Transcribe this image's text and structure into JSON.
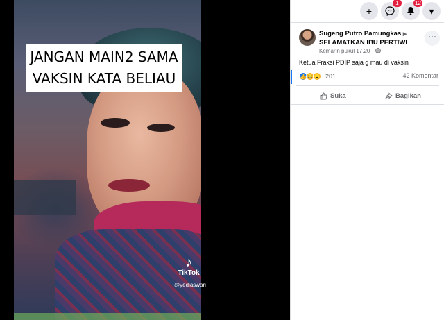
{
  "video": {
    "caption_line1": "JANGAN MAIN2 SAMA",
    "caption_line2": "VAKSIN KATA BELIAU",
    "watermark_logo": "♪",
    "watermark_name": "TikTok",
    "watermark_handle": "@yediaswari"
  },
  "topbar": {
    "add_icon": "+",
    "messenger_badge": "1",
    "notifications_badge": "12",
    "menu_icon": "▾"
  },
  "post": {
    "author": "Sugeng Putro Pamungkas",
    "group": "SELAMATKAN IBU PERTIWI",
    "timestamp": "Kemarin pukul 17.20",
    "privacy_icon": "globe-icon",
    "more_label": "···",
    "text": "Ketua Fraksi PDIP saja g mau di vaksin",
    "reaction_count": "201",
    "comment_count": "42 Komentar",
    "like_label": "Suka",
    "share_label": "Bagikan"
  },
  "colors": {
    "accent": "#1877f2",
    "badge": "#e41e3f"
  }
}
